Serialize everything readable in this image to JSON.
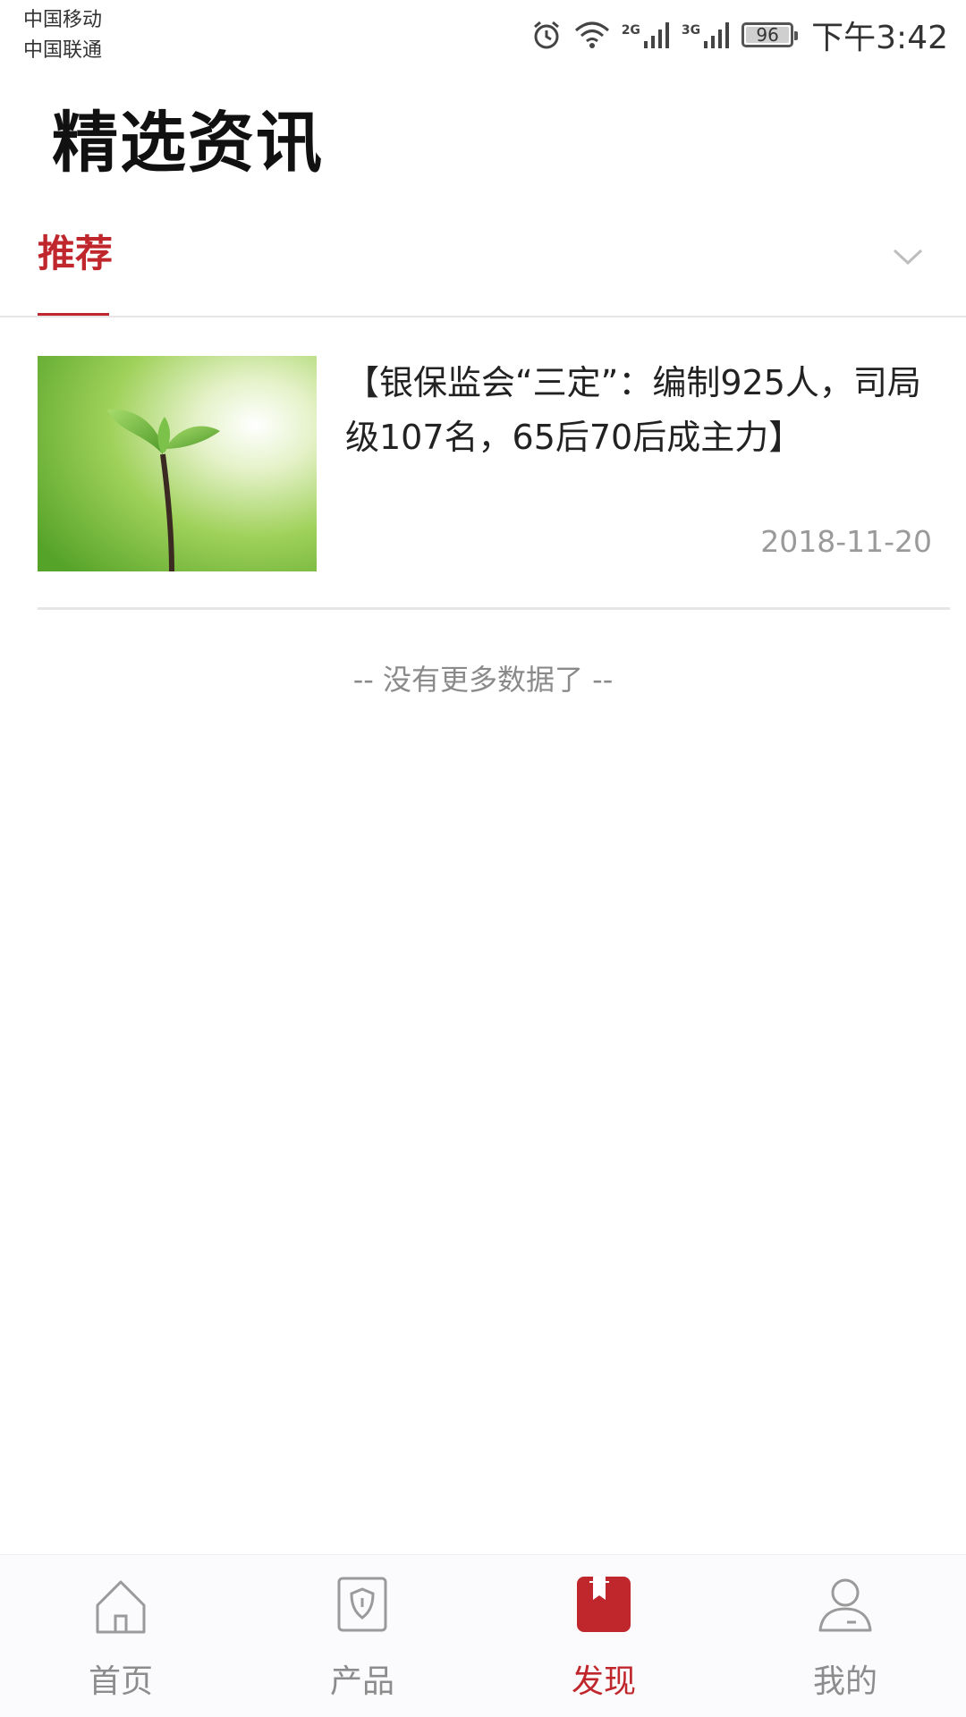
{
  "status_bar": {
    "carrier_1": "中国移动",
    "carrier_2": "中国联通",
    "net_1": "2G",
    "net_2": "3G",
    "battery": "96",
    "time": "下午3:42",
    "icons": [
      "alarm-icon",
      "wifi-icon",
      "signal-icon",
      "battery-icon"
    ]
  },
  "header": {
    "title": "精选资讯"
  },
  "tabs": {
    "active_label": "推荐",
    "expand_icon": "chevron-down-icon"
  },
  "articles": [
    {
      "title": "【银保监会“三定”：编制925人，司局级107名，65后70后成主力】",
      "date": "2018-11-20",
      "thumbnail": "sprout-image"
    }
  ],
  "list_footer": "-- 没有更多数据了 --",
  "bottom_nav": {
    "items": [
      {
        "label": "首页",
        "icon": "home-icon"
      },
      {
        "label": "产品",
        "icon": "shield-icon"
      },
      {
        "label": "发现",
        "icon": "bookmark-icon",
        "active": true
      },
      {
        "label": "我的",
        "icon": "user-icon"
      }
    ]
  },
  "colors": {
    "accent": "#c0272d",
    "inactive": "#8c8c8c",
    "divider": "#e6e6e6"
  }
}
